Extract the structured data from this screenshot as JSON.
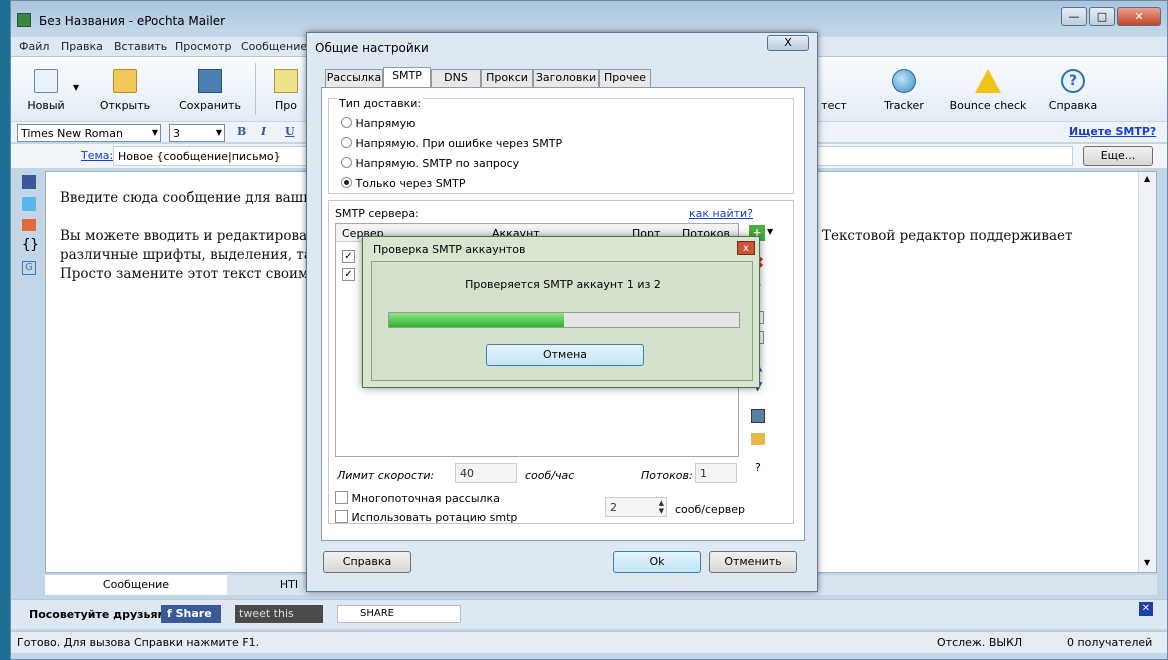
{
  "main": {
    "title": "Без Названия - ePochta Mailer",
    "menu": [
      "Файл",
      "Правка",
      "Вставить",
      "Просмотр",
      "Сообщение"
    ],
    "toolbar": {
      "new": "Новый",
      "open": "Открыть",
      "save": "Сохранить",
      "partial": "Про",
      "test": "тест",
      "tracker": "Tracker",
      "bounce": "Bounce check",
      "help": "Справка"
    },
    "format": {
      "font": "Times New Roman",
      "size": "3",
      "bold": "B",
      "italic": "I",
      "underline": "U"
    },
    "smtp_search_link": "Ищете SMTP?",
    "subject_label": "Тема:",
    "subject_value": "Новое {сообщение|письмо}",
    "more_button": "Еще...",
    "body_lines": [
      "Введите сюда сообщение для ваших",
      "Вы можете вводить и редактировать",
      "различные шрифты, выделения, табл",
      "Просто замените этот текст своим со"
    ],
    "body_right": "Текстовой редактор поддерживает",
    "tabs": {
      "message": "Сообщение",
      "html": "HTI"
    },
    "share": {
      "label": "Посоветуйте друзьям:",
      "facebook": "Share",
      "tweet": "tweet this",
      "share_all": "SHARE"
    },
    "status": {
      "ready": "Готово. Для вызова Справки нажмите F1.",
      "tracking": "Отслеж. ВЫКЛ",
      "recipients": "0 получателей"
    }
  },
  "settings": {
    "title": "Общие настройки",
    "close": "X",
    "tabs": [
      "Рассылка",
      "SMTP",
      "DNS",
      "Прокси",
      "Заголовки",
      "Прочее"
    ],
    "delivery_label": "Тип доставки:",
    "delivery_options": [
      "Напрямую",
      "Напрямую. При ошибке через SMTP",
      "Напрямую. SMTP по запросу",
      "Только через SMTP"
    ],
    "delivery_selected": 3,
    "smtp_servers_label": "SMTP сервера:",
    "how_find": "как найти?",
    "columns": [
      "Сервер",
      "Аккаунт",
      "Порт",
      "Потоков"
    ],
    "speed_label": "Лимит скорости:",
    "speed_value": "40",
    "speed_unit": "сооб/час",
    "threads_label": "Потоков:",
    "threads_value": "1",
    "multithread": "Многопоточная рассылка",
    "rotation": "Использовать ротацию smtp",
    "rotation_value": "2",
    "rotation_unit": "сооб/сервер",
    "help_btn": "Справка",
    "ok_btn": "Ok",
    "cancel_btn": "Отменить",
    "side_q": "?"
  },
  "progress": {
    "title": "Проверка SMTP аккаунтов",
    "close": "x",
    "message": "Проверяется SMTP аккаунт 1 из 2",
    "fraction": 0.5,
    "cancel": "Отмена"
  },
  "colors": {
    "accent": "#1a3ecb",
    "progress": "#3fc23b"
  }
}
